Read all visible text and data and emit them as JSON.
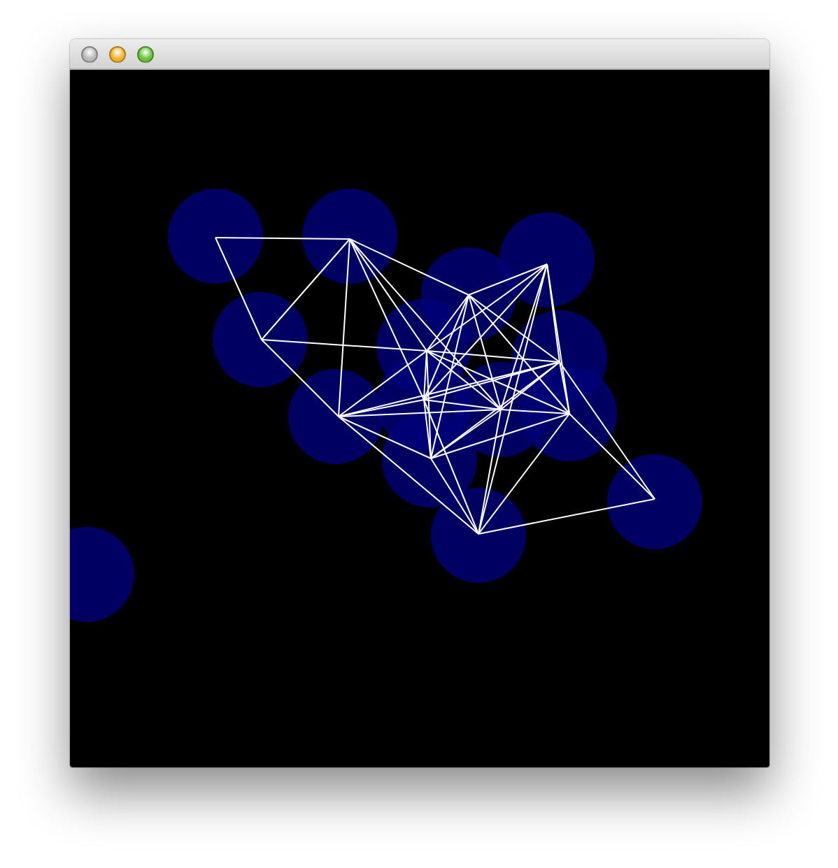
{
  "window": {
    "controls": [
      {
        "kind": "close",
        "enabled": false
      },
      {
        "kind": "minimize",
        "enabled": true
      },
      {
        "kind": "zoom",
        "enabled": true
      }
    ]
  }
}
